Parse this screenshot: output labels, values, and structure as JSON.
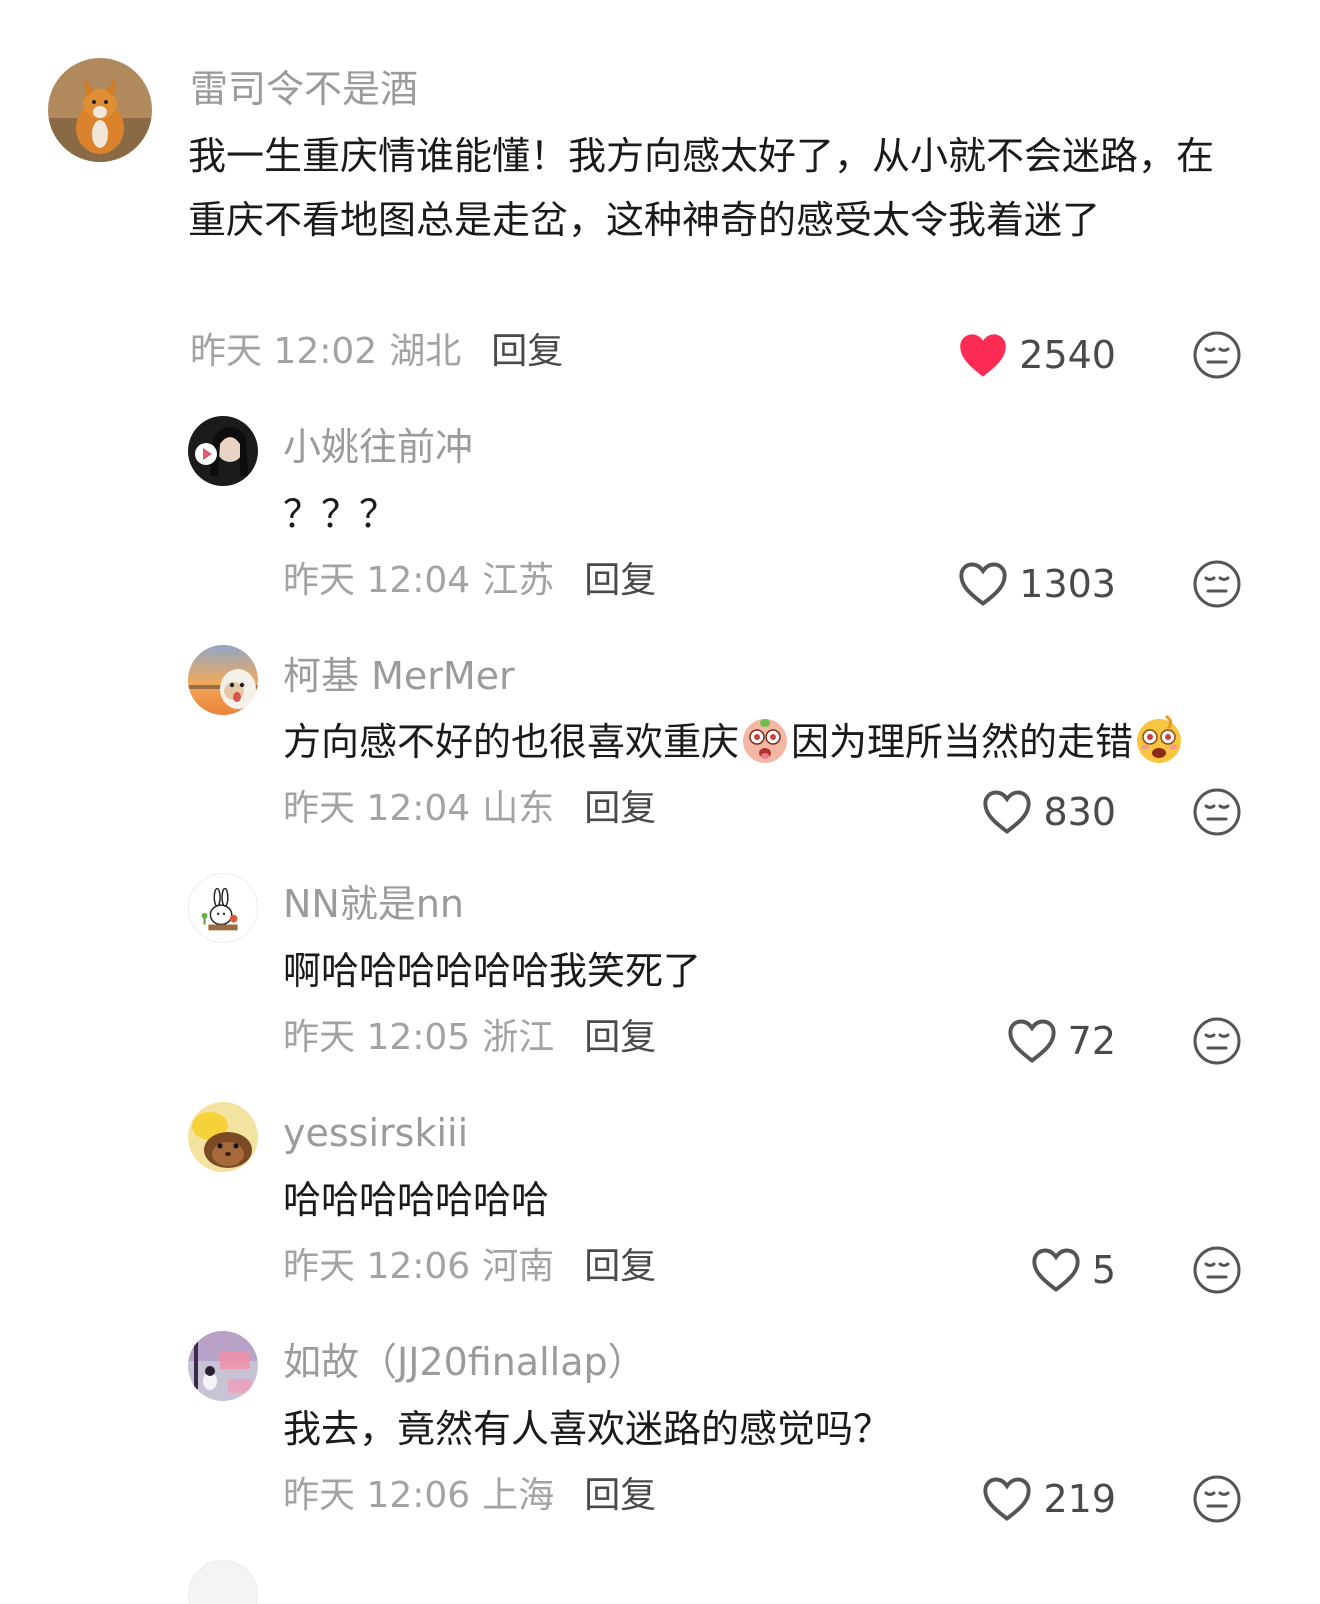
{
  "comments": [
    {
      "username": "雷司令不是酒",
      "content": "我一生重庆情谁能懂！我方向感太好了，从小就不会迷路，在重庆不看地图总是走岔，这种神奇的感受太令我着迷了",
      "time": "昨天 12:02",
      "location": "湖北",
      "reply_label": "回复",
      "like_count": "2540",
      "liked": true
    },
    {
      "username": "小姚往前冲",
      "content": "？？？",
      "time": "昨天 12:04",
      "location": "江苏",
      "reply_label": "回复",
      "like_count": "1303",
      "liked": false
    },
    {
      "username": "柯基 MerMer",
      "content_part1": "方向感不好的也很喜欢重庆",
      "content_part2": "因为理所当然的走错",
      "time": "昨天 12:04",
      "location": "山东",
      "reply_label": "回复",
      "like_count": "830",
      "liked": false
    },
    {
      "username": "NN就是nn",
      "content": "啊哈哈哈哈哈哈我笑死了",
      "time": "昨天 12:05",
      "location": "浙江",
      "reply_label": "回复",
      "like_count": "72",
      "liked": false
    },
    {
      "username": "yessirskiii",
      "content": "哈哈哈哈哈哈哈",
      "time": "昨天 12:06",
      "location": "河南",
      "reply_label": "回复",
      "like_count": "5",
      "liked": false
    },
    {
      "username": "如故（JJ20finallap）",
      "content": "我去，竟然有人喜欢迷路的感觉吗？",
      "time": "昨天 12:06",
      "location": "上海",
      "reply_label": "回复",
      "like_count": "219",
      "liked": false
    }
  ],
  "colors": {
    "liked_heart": "#fe2c55",
    "username": "#9b9b9b",
    "text": "#1a1a1a",
    "meta": "#a3a3a3"
  }
}
